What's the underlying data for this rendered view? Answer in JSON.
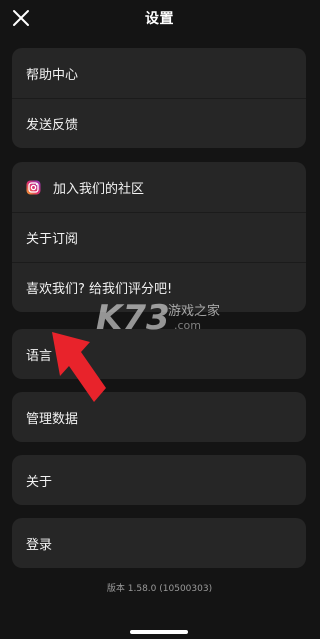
{
  "header": {
    "title": "设置",
    "close_icon": "close-icon"
  },
  "groups": {
    "help": {
      "items": [
        "帮助中心",
        "发送反馈"
      ]
    },
    "community": {
      "items": [
        "加入我们的社区",
        "关于订阅",
        "喜欢我们? 给我们评分吧!"
      ],
      "icon": "instagram-icon"
    },
    "language": {
      "label": "语言"
    },
    "data": {
      "label": "管理数据"
    },
    "about": {
      "label": "关于"
    },
    "login": {
      "label": "登录"
    }
  },
  "footer": {
    "version": "版本 1.58.0 (10500303)"
  },
  "watermark": {
    "logo": "K73",
    "text": "游戏之家",
    "domain": ".com"
  },
  "colors": {
    "background": "#141414",
    "card": "#262626",
    "text": "#f2f2f2",
    "arrow": "#e8232b"
  }
}
